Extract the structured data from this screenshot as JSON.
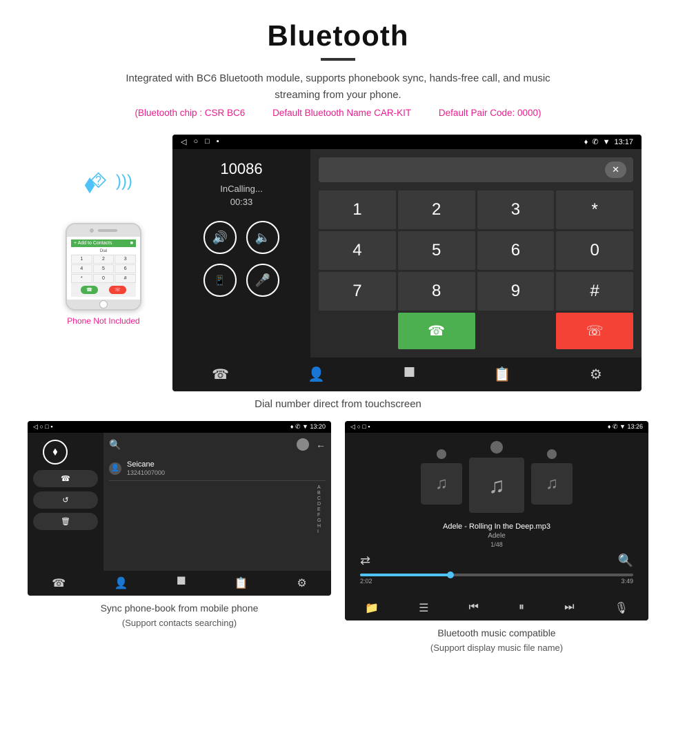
{
  "header": {
    "title": "Bluetooth",
    "description": "Integrated with BC6 Bluetooth module, supports phonebook sync, hands-free call, and music streaming from your phone.",
    "spec1": "(Bluetooth chip : CSR BC6",
    "spec2": "Default Bluetooth Name CAR-KIT",
    "spec3": "Default Pair Code: 0000)"
  },
  "phone_label": "Phone Not Included",
  "screen1": {
    "status_left": [
      "◁",
      "○",
      "□",
      "▪"
    ],
    "status_right": [
      "♦",
      "✆",
      "▼",
      "13:17"
    ],
    "call_number": "10086",
    "call_status": "InCalling...",
    "call_timer": "00:33",
    "dialpad": [
      "1",
      "2",
      "3",
      "*",
      "4",
      "5",
      "6",
      "0",
      "7",
      "8",
      "9",
      "#"
    ],
    "btn_call": "✆",
    "btn_end": "📞"
  },
  "caption1": "Dial number direct from touchscreen",
  "screen2": {
    "status_time": "13:20",
    "contact_name": "Seicane",
    "contact_number": "13241007000"
  },
  "caption2_line1": "Sync phone-book from mobile phone",
  "caption2_line2": "(Support contacts searching)",
  "screen3": {
    "status_time": "13:26",
    "track_name": "Adele - Rolling In the Deep.mp3",
    "artist": "Adele",
    "track_count": "1/48",
    "time_current": "2:02",
    "time_total": "3:49"
  },
  "caption3_line1": "Bluetooth music compatible",
  "caption3_line2": "(Support display music file name)"
}
